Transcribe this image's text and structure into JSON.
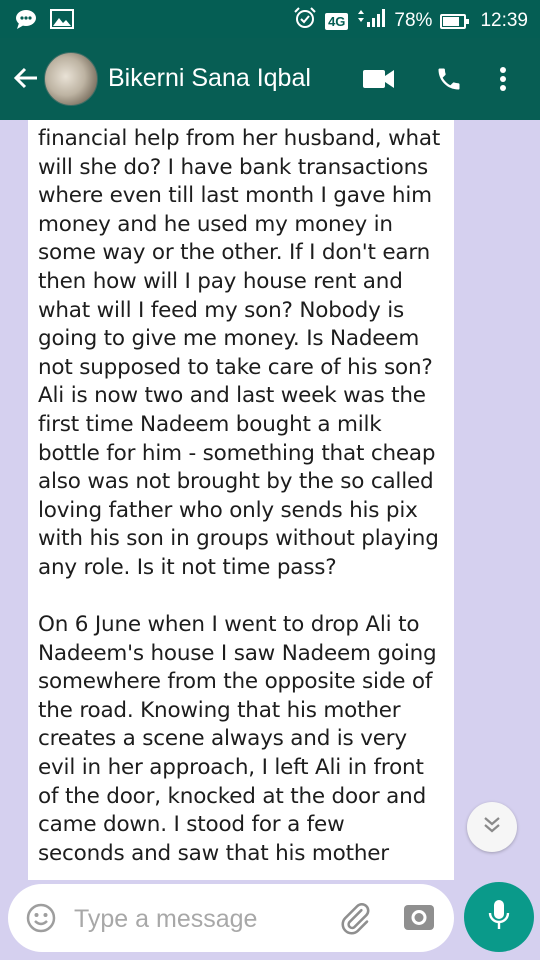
{
  "status_bar": {
    "network": "4G",
    "battery": "78%",
    "battery_level": 0.78,
    "time": "12:39",
    "icons": [
      "chat-notification-icon",
      "image-notification-icon",
      "alarm-icon",
      "signal-icon",
      "battery-icon"
    ]
  },
  "chat_header": {
    "contact_name": "Bikerni Sana Iqbal",
    "icons": [
      "back-arrow-icon",
      "video-call-icon",
      "voice-call-icon",
      "more-options-icon"
    ]
  },
  "message": {
    "text": "financial help from her husband, what\nwill she do? I have bank transactions\nwhere even till last month I gave him\nmoney and he used my money in\nsome way or the other. If I don't earn\nthen how will I pay house rent and\nwhat will I feed my son? Nobody is\ngoing to give me money. Is Nadeem\nnot supposed to take care of his son?\nAli is now two and last week was the\nfirst time Nadeem bought a milk\nbottle for him - something that cheap\nalso was not brought by the so called\nloving father who only sends his pix\nwith his son in groups without playing\nany role. Is it not time pass?\n\nOn 6 June when I went to drop Ali to\nNadeem's house I saw Nadeem going\nsomewhere from the opposite side of\nthe road. Knowing that his mother\ncreates a scene always and is very\nevil in her approach, I left Ali in front\nof the door, knocked at the door and\ncame down. I stood for a few\nseconds and saw that his mother"
  },
  "composer": {
    "placeholder": "Type a message",
    "value": "",
    "icons": [
      "emoji-icon",
      "attachment-icon",
      "camera-icon",
      "microphone-icon"
    ]
  },
  "colors": {
    "header": "#075e54",
    "chat_background": "#d5d0ef",
    "bubble": "#ffffff",
    "mic_button": "#0a9a8a"
  }
}
